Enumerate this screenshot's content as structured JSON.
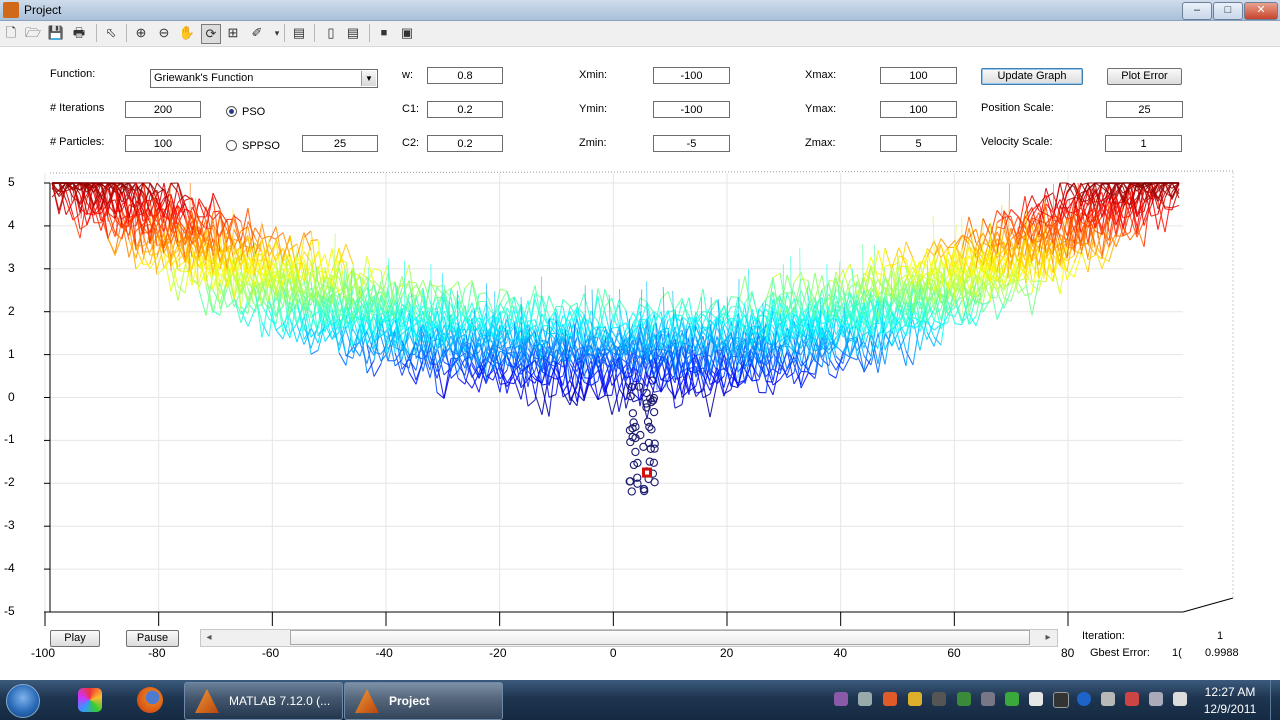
{
  "window": {
    "title": "Project",
    "minimize": "–",
    "maximize": "□",
    "close": "✕"
  },
  "toolbar": {
    "icons": [
      "new-figure-icon",
      "open-file-icon",
      "save-icon",
      "print-icon",
      "edit-plot-icon",
      "zoom-in-icon",
      "zoom-out-icon",
      "pan-icon",
      "rotate-3d-icon",
      "data-cursor-icon",
      "brush-icon",
      "link-plot-icon",
      "colorbar-icon",
      "legend-icon",
      "hide-plot-tools-icon",
      "show-plot-tools-icon"
    ]
  },
  "controls": {
    "function_label": "Function:",
    "function_value": "Griewank's Function",
    "iterations_label": "# Iterations",
    "iterations_value": "200",
    "particles_label": "# Particles:",
    "particles_value": "100",
    "pso_label": "PSO",
    "sppso_label": "SPPSO",
    "sppso_value": "25",
    "w_label": "w:",
    "w_value": "0.8",
    "c1_label": "C1:",
    "c1_value": "0.2",
    "c2_label": "C2:",
    "c2_value": "0.2",
    "xmin_label": "Xmin:",
    "xmin_value": "-100",
    "ymin_label": "Ymin:",
    "ymin_value": "-100",
    "zmin_label": "Zmin:",
    "zmin_value": "-5",
    "xmax_label": "Xmax:",
    "xmax_value": "100",
    "ymax_label": "Ymax:",
    "ymax_value": "100",
    "zmax_label": "Zmax:",
    "zmax_value": "5",
    "update_graph": "Update Graph",
    "plot_error": "Plot Error",
    "position_scale_label": "Position Scale:",
    "position_scale_value": "25",
    "velocity_scale_label": "Velocity Scale:",
    "velocity_scale_value": "1"
  },
  "playback": {
    "play": "Play",
    "pause": "Pause",
    "slider_left": "◂",
    "slider_right": "▸",
    "iteration_label": "Iteration:",
    "iteration_value": "1",
    "gbest_label": "Gbest Error:",
    "gbest_value": "0.9988",
    "gbest_clipped": "1("
  },
  "chart_data": {
    "type": "surface",
    "z_ticks": [
      "5",
      "4",
      "3",
      "2",
      "1",
      "0",
      "-1",
      "-2",
      "-3",
      "-4",
      "-5"
    ],
    "x_ticks": [
      "-100",
      "-80",
      "-60",
      "-40",
      "-20",
      "0",
      "20",
      "40",
      "60",
      "80"
    ],
    "zlim": [
      -5,
      5
    ],
    "xlim": [
      -100,
      100
    ],
    "colormap": "jet",
    "particles": {
      "count": 100,
      "color": "#1a1a6e",
      "marker": "circle"
    },
    "gbest": {
      "color": "#d01010",
      "marker": "square"
    }
  },
  "taskbar": {
    "tasks": [
      {
        "label": "MATLAB  7.12.0 (..."
      },
      {
        "label": "Project"
      }
    ],
    "time": "12:27 AM",
    "date": "12/9/2011"
  }
}
